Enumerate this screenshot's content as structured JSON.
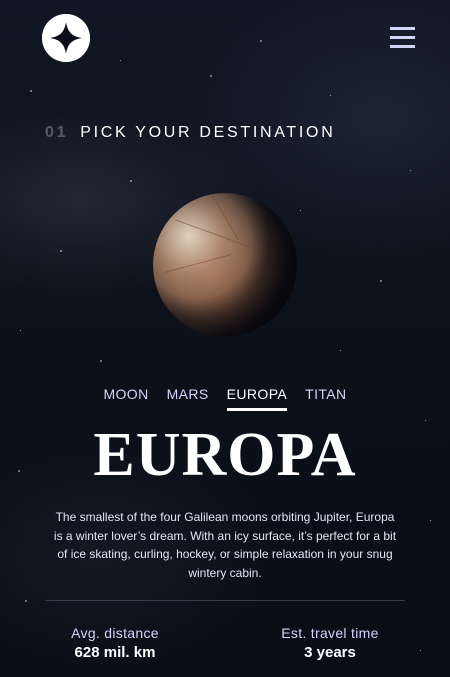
{
  "header": {
    "logo_icon": "star-logo-icon",
    "menu_icon": "hamburger-menu-icon"
  },
  "heading": {
    "number": "01",
    "text": "PICK YOUR DESTINATION"
  },
  "planet_image": "europa-planet-image",
  "tabs": [
    {
      "label": "MOON",
      "active": false
    },
    {
      "label": "MARS",
      "active": false
    },
    {
      "label": "EUROPA",
      "active": true
    },
    {
      "label": "TITAN",
      "active": false
    }
  ],
  "destination": {
    "name": "EUROPA",
    "description": "The smallest of the four Galilean moons orbiting Jupiter, Europa is a winter lover’s dream. With an icy surface, it’s perfect for a bit of ice skating, curling, hockey, or simple relaxation in your snug wintery cabin."
  },
  "stats": {
    "distance_label": "Avg. distance",
    "distance_value": "628 mil. km",
    "travel_label": "Est. travel time",
    "travel_value": "3 years"
  },
  "colors": {
    "background": "#0b0d17",
    "accent": "#d0d6f9",
    "text": "#ffffff"
  }
}
